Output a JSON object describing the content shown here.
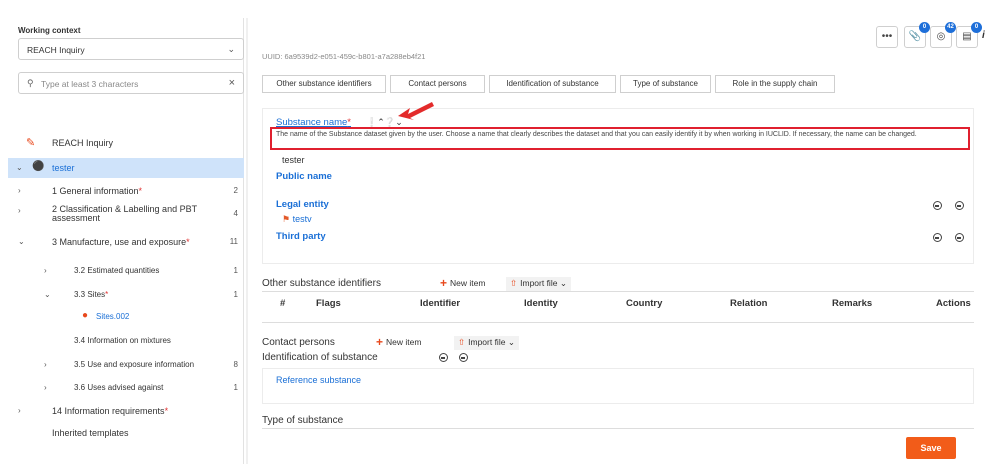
{
  "sidebar": {
    "context_label": "Working context",
    "context_value": "REACH Inquiry",
    "search_placeholder": "Type at least 3 characters",
    "root_item": "REACH Inquiry",
    "dataset_item": "tester",
    "items": [
      {
        "label": "1 General information",
        "required": true,
        "count": "2"
      },
      {
        "label": "2 Classification & Labelling and PBT",
        "label2": "assessment",
        "required": false,
        "count": "4"
      },
      {
        "label": "3 Manufacture, use and exposure",
        "required": true,
        "count": "11"
      },
      {
        "label": "3.2 Estimated quantities",
        "required": false,
        "count": "1"
      },
      {
        "label": "3.3 Sites",
        "required": true,
        "count": "1"
      },
      {
        "label": "Sites.002",
        "required": false,
        "count": ""
      },
      {
        "label": "3.4 Information on mixtures",
        "required": false,
        "count": ""
      },
      {
        "label": "3.5 Use and exposure information",
        "required": false,
        "count": "8"
      },
      {
        "label": "3.6 Uses advised against",
        "required": false,
        "count": "1"
      },
      {
        "label": "14 Information requirements",
        "required": true,
        "count": ""
      },
      {
        "label": "Inherited templates",
        "required": false,
        "count": ""
      }
    ]
  },
  "toolbar": {
    "more_label": "•••",
    "badges": [
      "0",
      "42",
      "0"
    ]
  },
  "main": {
    "uuid": "UUID: 6a9539d2-e051-459c-b801-a7a288eb4f21",
    "tabs": [
      "Other substance identifiers",
      "Contact persons",
      "Identification of substance",
      "Type of substance",
      "Role in the supply chain"
    ],
    "substance_name_label": "Substance name",
    "tooltip": "The name of the Substance dataset given by the user. Choose a name that clearly describes the dataset and that you can easily identify it by when working in IUCLID. If necessary, the name can be changed.",
    "substance_name_value": "tester",
    "public_name_label": "Public name",
    "legal_entity_label": "Legal entity",
    "legal_entity_value": "testv",
    "third_party_label": "Third party",
    "other_ids_title": "Other substance identifiers",
    "new_item_label": "New item",
    "import_file_label": "Import file",
    "table_headers": [
      "#",
      "Flags",
      "Identifier",
      "Identity",
      "Country",
      "Relation",
      "Remarks",
      "Actions"
    ],
    "contact_persons_title": "Contact persons",
    "identification_title": "Identification of substance",
    "reference_substance_label": "Reference substance",
    "type_of_substance_title": "Type of substance",
    "save_label": "Save"
  }
}
